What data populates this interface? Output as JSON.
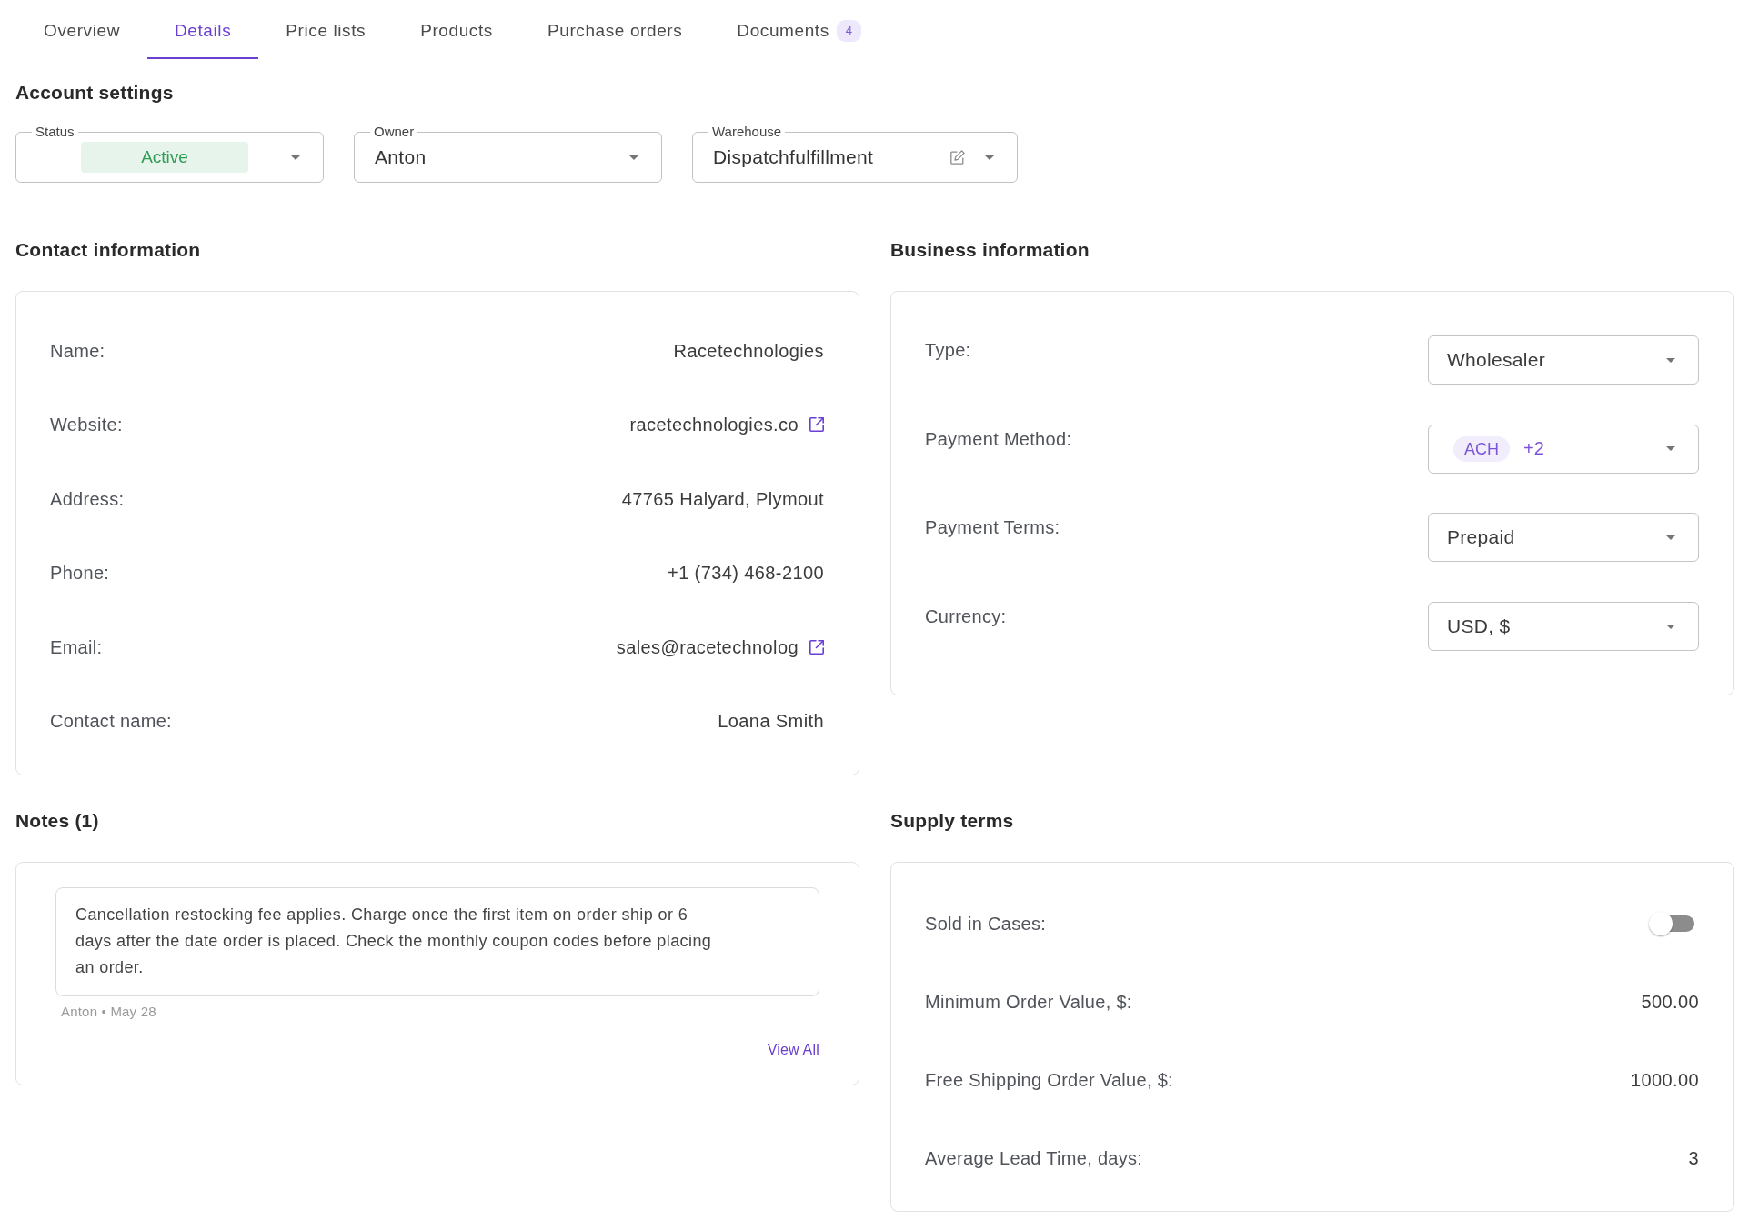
{
  "tabs": [
    {
      "label": "Overview",
      "selected": false
    },
    {
      "label": "Details",
      "selected": true
    },
    {
      "label": "Price lists",
      "selected": false
    },
    {
      "label": "Products",
      "selected": false
    },
    {
      "label": "Purchase orders",
      "selected": false
    },
    {
      "label": "Documents",
      "badge": "4",
      "selected": false
    }
  ],
  "account_settings": {
    "title": "Account settings",
    "fields": [
      {
        "kind": "status",
        "label": "Status",
        "value": "Active"
      },
      {
        "kind": "select",
        "label": "Owner",
        "value": "Anton"
      },
      {
        "kind": "editable_select",
        "label": "Warehouse",
        "value": "Dispatchfulfillment"
      }
    ]
  },
  "contact_information": {
    "title": "Contact information",
    "rows": [
      {
        "kind": "text",
        "label": "Name:",
        "value": "Racetechnologies"
      },
      {
        "kind": "link",
        "label": "Website:",
        "value": "racetechnologies.co"
      },
      {
        "kind": "text",
        "label": "Address:",
        "value": "47765 Halyard, Plymout"
      },
      {
        "kind": "text",
        "label": "Phone:",
        "value": "+1 (734) 468-2100"
      },
      {
        "kind": "link",
        "label": "Email:",
        "value": "sales@racetechnolog"
      },
      {
        "kind": "text",
        "label": "Contact name:",
        "value": "Loana Smith"
      }
    ]
  },
  "business_information": {
    "title": "Business information",
    "rows": [
      {
        "kind": "select",
        "label": "Type:",
        "value": "Wholesaler"
      },
      {
        "kind": "multi_select",
        "label": "Payment Method:",
        "chips": [
          "ACH"
        ],
        "more": "+2"
      },
      {
        "kind": "select",
        "label": "Payment Terms:",
        "value": "Prepaid"
      },
      {
        "kind": "select",
        "label": "Currency:",
        "value": "USD, $"
      }
    ]
  },
  "notes": {
    "title": "Notes (1)",
    "items": [
      {
        "text": "Cancellation restocking fee applies. Charge once the first item on order ship or 6 days after the date order is placed. Check the monthly coupon codes before placing an order.",
        "meta": "Anton • May 28"
      }
    ],
    "view_all": "View All"
  },
  "supply_terms": {
    "title": "Supply terms",
    "rows": [
      {
        "kind": "toggle",
        "label": "Sold in Cases:",
        "on": false
      },
      {
        "kind": "value",
        "label": "Minimum Order Value, $:",
        "value": "500.00"
      },
      {
        "kind": "value",
        "label": "Free Shipping Order Value, $:",
        "value": "1000.00"
      },
      {
        "kind": "value",
        "label": "Average Lead Time, days:",
        "value": "3"
      }
    ]
  }
}
